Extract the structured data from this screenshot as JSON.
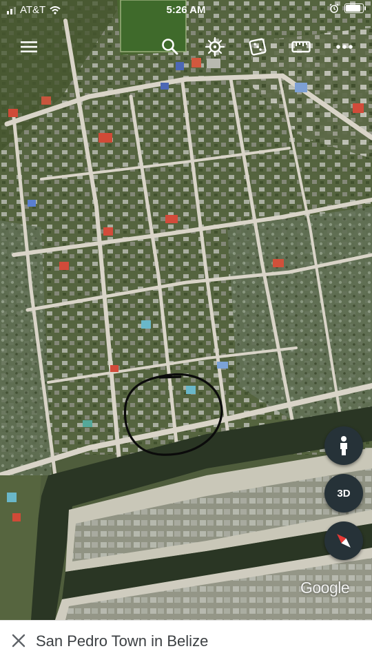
{
  "status_bar": {
    "carrier": "AT&T",
    "time": "5:26 AM",
    "battery_level": 0.95
  },
  "toolbar": {
    "icons": [
      "menu-icon",
      "search-icon",
      "voyager-icon",
      "feeling-lucky-icon",
      "measure-icon",
      "more-icon"
    ]
  },
  "map": {
    "attribution": "Google",
    "annotation": "hand-drawn black circle around a block near the canal",
    "colors": {
      "land": "#4f5d3c",
      "vegetation": "#3f4f2c",
      "road": "#d9d4c8",
      "canal": "#2a3624",
      "sand": "#c9b593"
    }
  },
  "controls": {
    "street_view_icon": "pegman-icon",
    "three_d_label": "3D",
    "compass_icon": "compass-icon"
  },
  "place_card": {
    "title": "San Pedro Town in Belize"
  }
}
